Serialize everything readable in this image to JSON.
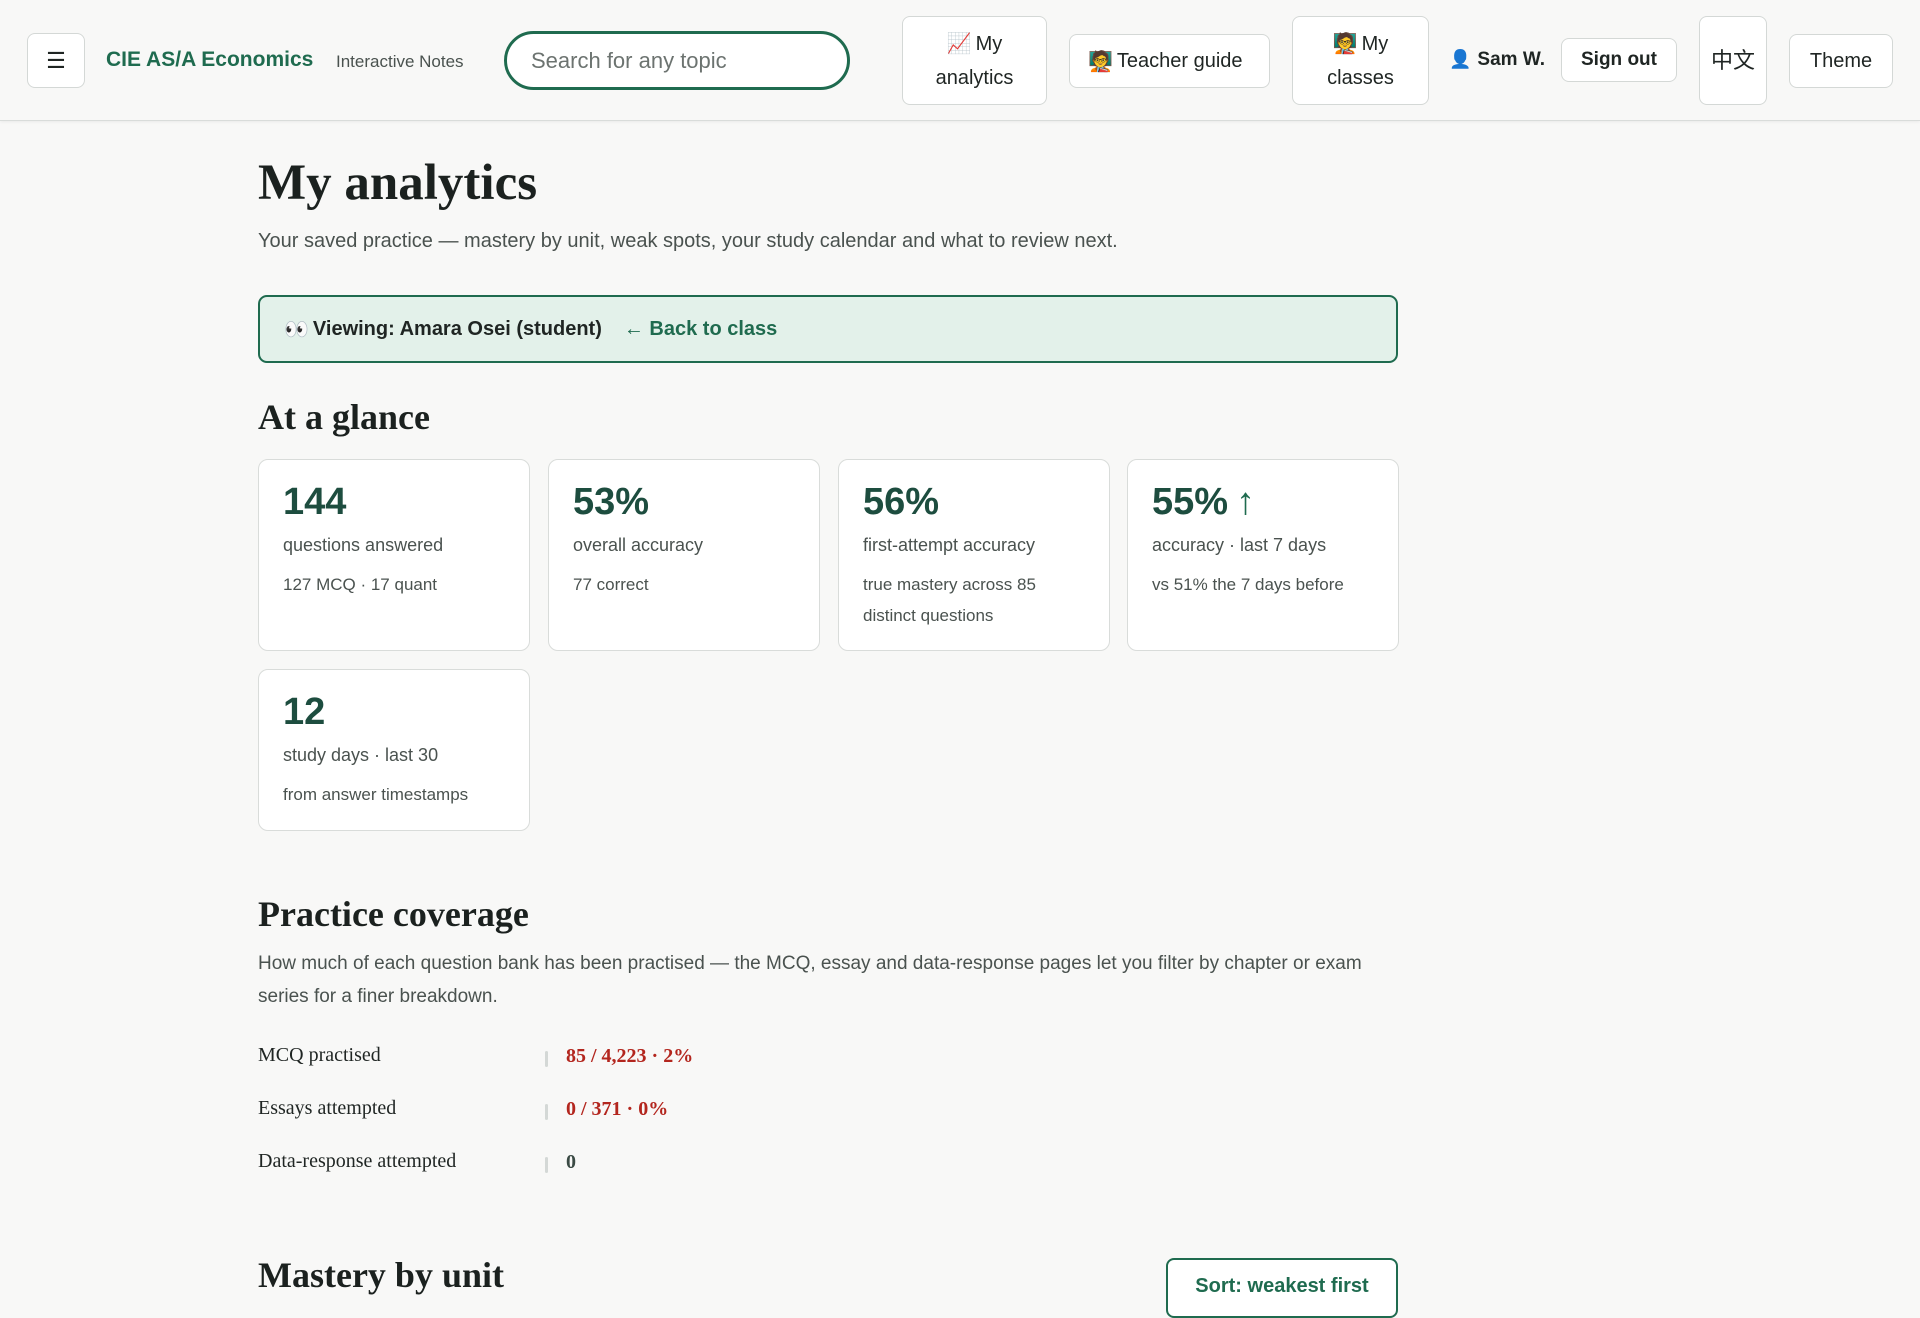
{
  "header": {
    "menu_icon": "☰",
    "brand": "CIE AS/A Economics",
    "brand_sub": "Interactive Notes",
    "search_placeholder": "Search for any topic",
    "nav": {
      "analytics": {
        "icon": "📈",
        "label": "My analytics"
      },
      "teacher": {
        "icon": "🧑‍🏫",
        "label": "Teacher guide"
      },
      "classes": {
        "icon": "🧑‍🏫",
        "label": "My classes"
      }
    },
    "user_icon": "👤",
    "user_name": "Sam W.",
    "sign_out": "Sign out",
    "lang": "中文",
    "theme": "Theme"
  },
  "page": {
    "title": "My analytics",
    "subtitle": "Your saved practice — mastery by unit, weak spots, your study calendar and what to review next."
  },
  "viewing": {
    "icon": "👀",
    "label": "Viewing: Amara Osei (student)",
    "back": "← Back to class"
  },
  "glance": {
    "heading": "At a glance",
    "cards": [
      {
        "value": "144",
        "label": "questions answered",
        "detail": "127 MCQ · 17 quant"
      },
      {
        "value": "53%",
        "label": "overall accuracy",
        "detail": "77 correct"
      },
      {
        "value": "56%",
        "label": "first-attempt accuracy",
        "detail": "true mastery across 85 distinct questions"
      },
      {
        "value": "55%",
        "arrow": "↑",
        "label": "accuracy · last 7 days",
        "detail": "vs 51% the 7 days before"
      },
      {
        "value": "12",
        "label": "study days · last 30",
        "detail": "from answer timestamps"
      }
    ]
  },
  "coverage": {
    "heading": "Practice coverage",
    "description": "How much of each question bank has been practised — the MCQ, essay and data-response pages let you filter by chapter or exam series for a finer breakdown.",
    "rows": [
      {
        "label": "MCQ practised",
        "value": "85 / 4,223 · 2%",
        "color": "#b3261e"
      },
      {
        "label": "Essays attempted",
        "value": "0 / 371 · 0%",
        "color": "#b3261e"
      },
      {
        "label": "Data-response attempted",
        "value": "0",
        "color": "#3a4a44"
      }
    ]
  },
  "mastery": {
    "heading": "Mastery by unit",
    "sort_label": "Sort: weakest first"
  },
  "colors": {
    "accent": "#1f6b4f",
    "stat_value": "#1d4d3f",
    "banner_bg": "#e3f1ea",
    "warning": "#b3261e"
  }
}
